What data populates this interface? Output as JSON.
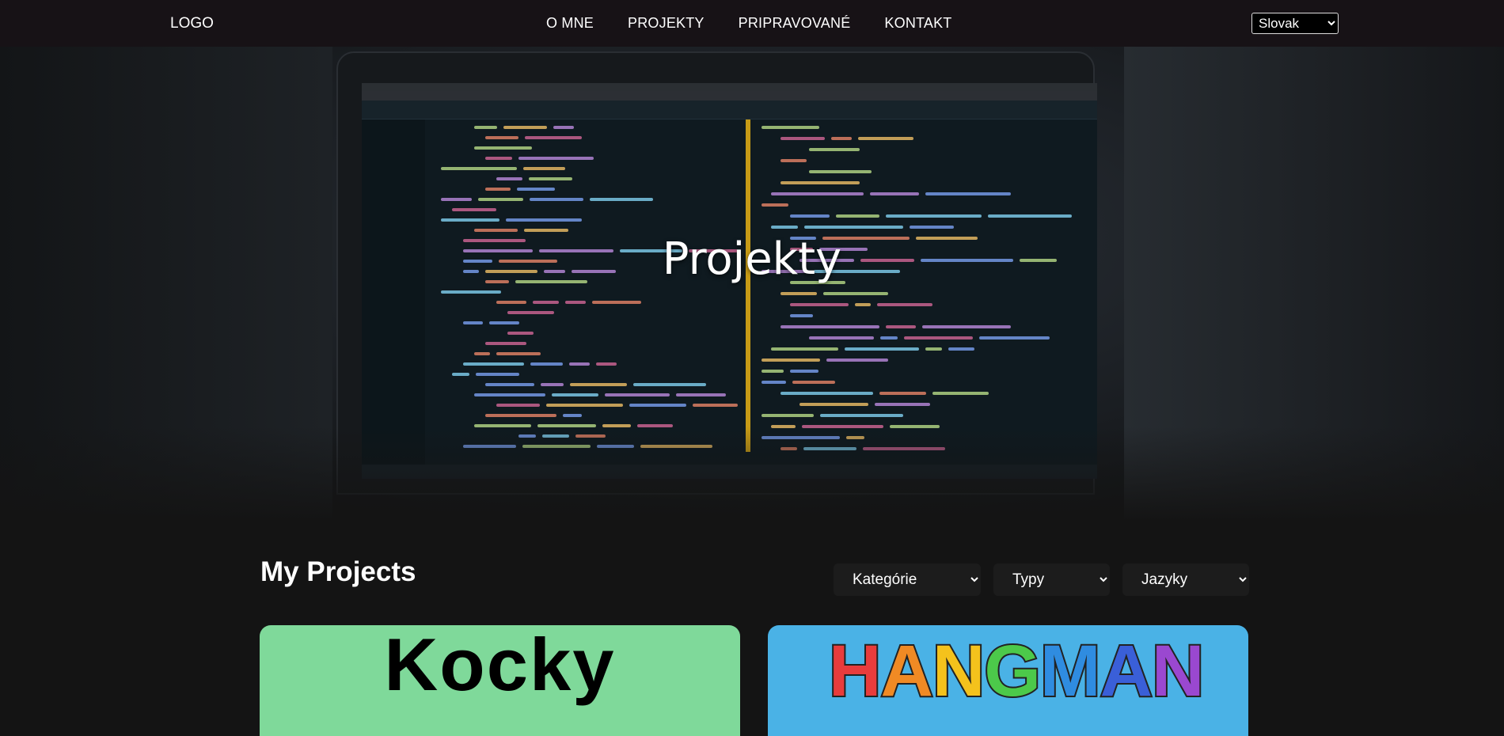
{
  "nav": {
    "logo": "LOGO",
    "links": [
      "O MNE",
      "PROJEKTY",
      "PRIPRAVOVANÉ",
      "KONTAKT"
    ],
    "language": {
      "selected": "Slovak"
    }
  },
  "hero": {
    "title": "Projekty"
  },
  "projects": {
    "heading": "My Projects",
    "filters": {
      "categories": "Kategórie",
      "types": "Typy",
      "languages": "Jazyky"
    },
    "cards": [
      {
        "title": "Kocky",
        "color": "#7fd99a"
      },
      {
        "title": "HANGMAN",
        "color": "#4ab2e6",
        "letter_colors": [
          "#e83c3c",
          "#f08a24",
          "#f4c21c",
          "#4cc94a",
          "#2f8ce0",
          "#3a5fd8",
          "#9a48d0"
        ]
      }
    ]
  }
}
